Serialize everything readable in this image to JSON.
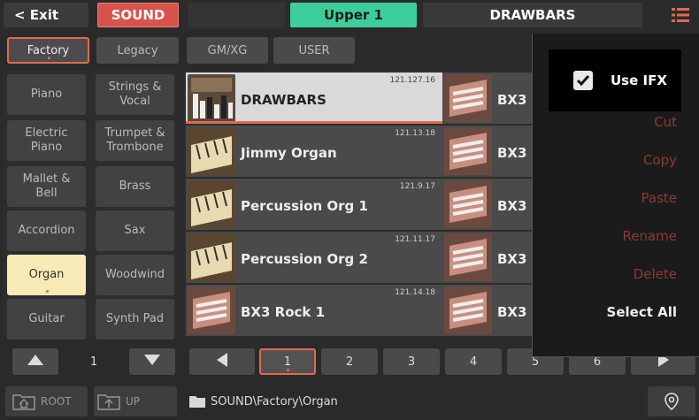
{
  "topbar": {
    "exit_label": "< Exit",
    "mode_label": "SOUND",
    "part_label": "Upper 1",
    "sound_name": "DRAWBARS",
    "menu_icon": "hamburger-list-icon"
  },
  "bank_tabs": [
    "Factory",
    "Legacy",
    "GM/XG",
    "USER"
  ],
  "categories": [
    "Piano",
    "Strings &\nVocal",
    "Electric\nPiano",
    "Trumpet &\nTrombone",
    "Mallet &\nBell",
    "Brass",
    "Accordion",
    "Sax",
    "Organ",
    "Woodwind",
    "Guitar",
    "Synth Pad"
  ],
  "sounds": [
    {
      "name": "DRAWBARS",
      "code": "121.127.16",
      "icon": "drawbar-organ-thumb"
    },
    {
      "name": "BX3",
      "code": "",
      "icon": "bx3-organ-thumb"
    },
    {
      "name": "Jimmy Organ",
      "code": "121.13.18",
      "icon": "organ-keys-thumb"
    },
    {
      "name": "BX3",
      "code": "",
      "icon": "bx3-organ-thumb"
    },
    {
      "name": "Percussion Org 1",
      "code": "121.9.17",
      "icon": "organ-keys-thumb"
    },
    {
      "name": "BX3",
      "code": "",
      "icon": "bx3-organ-thumb"
    },
    {
      "name": "Percussion Org 2",
      "code": "121.11.17",
      "icon": "organ-keys-thumb"
    },
    {
      "name": "BX3",
      "code": "",
      "icon": "bx3-organ-thumb"
    },
    {
      "name": "BX3 Rock 1",
      "code": "121.14.18",
      "icon": "bx3-organ-thumb"
    },
    {
      "name": "BX3",
      "code": "",
      "icon": "bx3-organ-thumb"
    }
  ],
  "category_page": "1",
  "sound_pages": [
    "1",
    "2",
    "3",
    "4",
    "5",
    "6"
  ],
  "footer": {
    "root_label": "ROOT",
    "up_label": "UP",
    "path": "SOUND\\Factory\\Organ"
  },
  "menu": {
    "use_ifx_label": "Use IFX",
    "items": [
      "Cut",
      "Copy",
      "Paste",
      "Rename",
      "Delete",
      "Select All"
    ]
  },
  "colors": {
    "accent": "#e06a4e",
    "sound_red": "#d8544b",
    "upper_green": "#3ccf9c",
    "selected_category": "#f7eab4"
  }
}
